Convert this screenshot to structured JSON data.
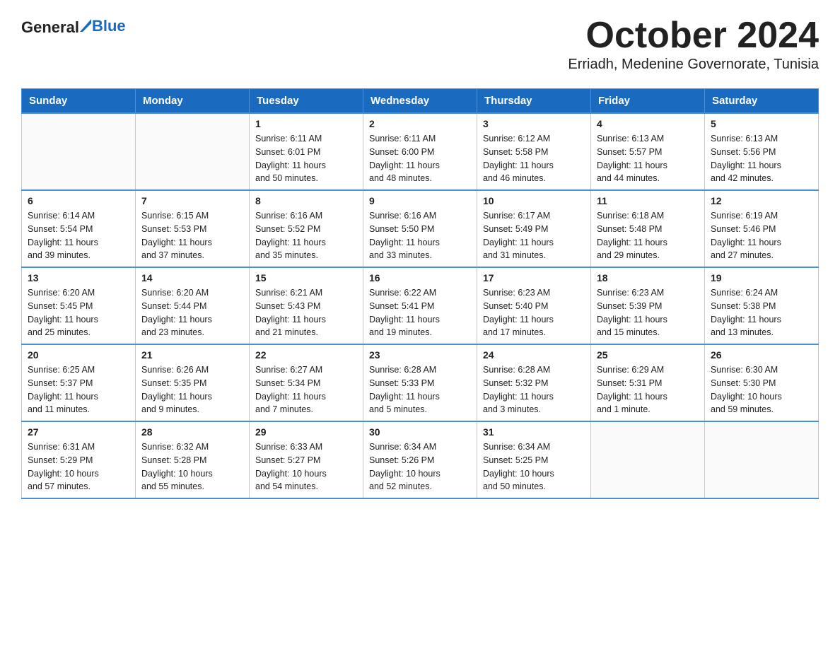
{
  "logo": {
    "text1": "General",
    "text2": "Blue"
  },
  "header": {
    "month_year": "October 2024",
    "location": "Erriadh, Medenine Governorate, Tunisia"
  },
  "weekdays": [
    "Sunday",
    "Monday",
    "Tuesday",
    "Wednesday",
    "Thursday",
    "Friday",
    "Saturday"
  ],
  "weeks": [
    [
      {
        "day": "",
        "info": ""
      },
      {
        "day": "",
        "info": ""
      },
      {
        "day": "1",
        "info": "Sunrise: 6:11 AM\nSunset: 6:01 PM\nDaylight: 11 hours\nand 50 minutes."
      },
      {
        "day": "2",
        "info": "Sunrise: 6:11 AM\nSunset: 6:00 PM\nDaylight: 11 hours\nand 48 minutes."
      },
      {
        "day": "3",
        "info": "Sunrise: 6:12 AM\nSunset: 5:58 PM\nDaylight: 11 hours\nand 46 minutes."
      },
      {
        "day": "4",
        "info": "Sunrise: 6:13 AM\nSunset: 5:57 PM\nDaylight: 11 hours\nand 44 minutes."
      },
      {
        "day": "5",
        "info": "Sunrise: 6:13 AM\nSunset: 5:56 PM\nDaylight: 11 hours\nand 42 minutes."
      }
    ],
    [
      {
        "day": "6",
        "info": "Sunrise: 6:14 AM\nSunset: 5:54 PM\nDaylight: 11 hours\nand 39 minutes."
      },
      {
        "day": "7",
        "info": "Sunrise: 6:15 AM\nSunset: 5:53 PM\nDaylight: 11 hours\nand 37 minutes."
      },
      {
        "day": "8",
        "info": "Sunrise: 6:16 AM\nSunset: 5:52 PM\nDaylight: 11 hours\nand 35 minutes."
      },
      {
        "day": "9",
        "info": "Sunrise: 6:16 AM\nSunset: 5:50 PM\nDaylight: 11 hours\nand 33 minutes."
      },
      {
        "day": "10",
        "info": "Sunrise: 6:17 AM\nSunset: 5:49 PM\nDaylight: 11 hours\nand 31 minutes."
      },
      {
        "day": "11",
        "info": "Sunrise: 6:18 AM\nSunset: 5:48 PM\nDaylight: 11 hours\nand 29 minutes."
      },
      {
        "day": "12",
        "info": "Sunrise: 6:19 AM\nSunset: 5:46 PM\nDaylight: 11 hours\nand 27 minutes."
      }
    ],
    [
      {
        "day": "13",
        "info": "Sunrise: 6:20 AM\nSunset: 5:45 PM\nDaylight: 11 hours\nand 25 minutes."
      },
      {
        "day": "14",
        "info": "Sunrise: 6:20 AM\nSunset: 5:44 PM\nDaylight: 11 hours\nand 23 minutes."
      },
      {
        "day": "15",
        "info": "Sunrise: 6:21 AM\nSunset: 5:43 PM\nDaylight: 11 hours\nand 21 minutes."
      },
      {
        "day": "16",
        "info": "Sunrise: 6:22 AM\nSunset: 5:41 PM\nDaylight: 11 hours\nand 19 minutes."
      },
      {
        "day": "17",
        "info": "Sunrise: 6:23 AM\nSunset: 5:40 PM\nDaylight: 11 hours\nand 17 minutes."
      },
      {
        "day": "18",
        "info": "Sunrise: 6:23 AM\nSunset: 5:39 PM\nDaylight: 11 hours\nand 15 minutes."
      },
      {
        "day": "19",
        "info": "Sunrise: 6:24 AM\nSunset: 5:38 PM\nDaylight: 11 hours\nand 13 minutes."
      }
    ],
    [
      {
        "day": "20",
        "info": "Sunrise: 6:25 AM\nSunset: 5:37 PM\nDaylight: 11 hours\nand 11 minutes."
      },
      {
        "day": "21",
        "info": "Sunrise: 6:26 AM\nSunset: 5:35 PM\nDaylight: 11 hours\nand 9 minutes."
      },
      {
        "day": "22",
        "info": "Sunrise: 6:27 AM\nSunset: 5:34 PM\nDaylight: 11 hours\nand 7 minutes."
      },
      {
        "day": "23",
        "info": "Sunrise: 6:28 AM\nSunset: 5:33 PM\nDaylight: 11 hours\nand 5 minutes."
      },
      {
        "day": "24",
        "info": "Sunrise: 6:28 AM\nSunset: 5:32 PM\nDaylight: 11 hours\nand 3 minutes."
      },
      {
        "day": "25",
        "info": "Sunrise: 6:29 AM\nSunset: 5:31 PM\nDaylight: 11 hours\nand 1 minute."
      },
      {
        "day": "26",
        "info": "Sunrise: 6:30 AM\nSunset: 5:30 PM\nDaylight: 10 hours\nand 59 minutes."
      }
    ],
    [
      {
        "day": "27",
        "info": "Sunrise: 6:31 AM\nSunset: 5:29 PM\nDaylight: 10 hours\nand 57 minutes."
      },
      {
        "day": "28",
        "info": "Sunrise: 6:32 AM\nSunset: 5:28 PM\nDaylight: 10 hours\nand 55 minutes."
      },
      {
        "day": "29",
        "info": "Sunrise: 6:33 AM\nSunset: 5:27 PM\nDaylight: 10 hours\nand 54 minutes."
      },
      {
        "day": "30",
        "info": "Sunrise: 6:34 AM\nSunset: 5:26 PM\nDaylight: 10 hours\nand 52 minutes."
      },
      {
        "day": "31",
        "info": "Sunrise: 6:34 AM\nSunset: 5:25 PM\nDaylight: 10 hours\nand 50 minutes."
      },
      {
        "day": "",
        "info": ""
      },
      {
        "day": "",
        "info": ""
      }
    ]
  ]
}
